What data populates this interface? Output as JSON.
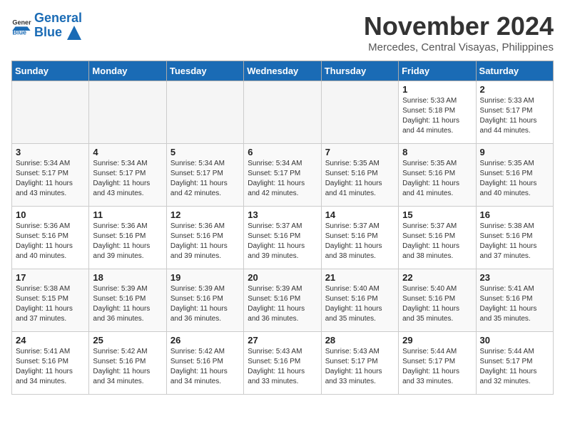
{
  "header": {
    "logo_text_general": "General",
    "logo_text_blue": "Blue",
    "month_title": "November 2024",
    "location": "Mercedes, Central Visayas, Philippines"
  },
  "days_of_week": [
    "Sunday",
    "Monday",
    "Tuesday",
    "Wednesday",
    "Thursday",
    "Friday",
    "Saturday"
  ],
  "weeks": [
    [
      {
        "day": "",
        "info": ""
      },
      {
        "day": "",
        "info": ""
      },
      {
        "day": "",
        "info": ""
      },
      {
        "day": "",
        "info": ""
      },
      {
        "day": "",
        "info": ""
      },
      {
        "day": "1",
        "info": "Sunrise: 5:33 AM\nSunset: 5:18 PM\nDaylight: 11 hours and 44 minutes."
      },
      {
        "day": "2",
        "info": "Sunrise: 5:33 AM\nSunset: 5:17 PM\nDaylight: 11 hours and 44 minutes."
      }
    ],
    [
      {
        "day": "3",
        "info": "Sunrise: 5:34 AM\nSunset: 5:17 PM\nDaylight: 11 hours and 43 minutes."
      },
      {
        "day": "4",
        "info": "Sunrise: 5:34 AM\nSunset: 5:17 PM\nDaylight: 11 hours and 43 minutes."
      },
      {
        "day": "5",
        "info": "Sunrise: 5:34 AM\nSunset: 5:17 PM\nDaylight: 11 hours and 42 minutes."
      },
      {
        "day": "6",
        "info": "Sunrise: 5:34 AM\nSunset: 5:17 PM\nDaylight: 11 hours and 42 minutes."
      },
      {
        "day": "7",
        "info": "Sunrise: 5:35 AM\nSunset: 5:16 PM\nDaylight: 11 hours and 41 minutes."
      },
      {
        "day": "8",
        "info": "Sunrise: 5:35 AM\nSunset: 5:16 PM\nDaylight: 11 hours and 41 minutes."
      },
      {
        "day": "9",
        "info": "Sunrise: 5:35 AM\nSunset: 5:16 PM\nDaylight: 11 hours and 40 minutes."
      }
    ],
    [
      {
        "day": "10",
        "info": "Sunrise: 5:36 AM\nSunset: 5:16 PM\nDaylight: 11 hours and 40 minutes."
      },
      {
        "day": "11",
        "info": "Sunrise: 5:36 AM\nSunset: 5:16 PM\nDaylight: 11 hours and 39 minutes."
      },
      {
        "day": "12",
        "info": "Sunrise: 5:36 AM\nSunset: 5:16 PM\nDaylight: 11 hours and 39 minutes."
      },
      {
        "day": "13",
        "info": "Sunrise: 5:37 AM\nSunset: 5:16 PM\nDaylight: 11 hours and 39 minutes."
      },
      {
        "day": "14",
        "info": "Sunrise: 5:37 AM\nSunset: 5:16 PM\nDaylight: 11 hours and 38 minutes."
      },
      {
        "day": "15",
        "info": "Sunrise: 5:37 AM\nSunset: 5:16 PM\nDaylight: 11 hours and 38 minutes."
      },
      {
        "day": "16",
        "info": "Sunrise: 5:38 AM\nSunset: 5:16 PM\nDaylight: 11 hours and 37 minutes."
      }
    ],
    [
      {
        "day": "17",
        "info": "Sunrise: 5:38 AM\nSunset: 5:15 PM\nDaylight: 11 hours and 37 minutes."
      },
      {
        "day": "18",
        "info": "Sunrise: 5:39 AM\nSunset: 5:16 PM\nDaylight: 11 hours and 36 minutes."
      },
      {
        "day": "19",
        "info": "Sunrise: 5:39 AM\nSunset: 5:16 PM\nDaylight: 11 hours and 36 minutes."
      },
      {
        "day": "20",
        "info": "Sunrise: 5:39 AM\nSunset: 5:16 PM\nDaylight: 11 hours and 36 minutes."
      },
      {
        "day": "21",
        "info": "Sunrise: 5:40 AM\nSunset: 5:16 PM\nDaylight: 11 hours and 35 minutes."
      },
      {
        "day": "22",
        "info": "Sunrise: 5:40 AM\nSunset: 5:16 PM\nDaylight: 11 hours and 35 minutes."
      },
      {
        "day": "23",
        "info": "Sunrise: 5:41 AM\nSunset: 5:16 PM\nDaylight: 11 hours and 35 minutes."
      }
    ],
    [
      {
        "day": "24",
        "info": "Sunrise: 5:41 AM\nSunset: 5:16 PM\nDaylight: 11 hours and 34 minutes."
      },
      {
        "day": "25",
        "info": "Sunrise: 5:42 AM\nSunset: 5:16 PM\nDaylight: 11 hours and 34 minutes."
      },
      {
        "day": "26",
        "info": "Sunrise: 5:42 AM\nSunset: 5:16 PM\nDaylight: 11 hours and 34 minutes."
      },
      {
        "day": "27",
        "info": "Sunrise: 5:43 AM\nSunset: 5:16 PM\nDaylight: 11 hours and 33 minutes."
      },
      {
        "day": "28",
        "info": "Sunrise: 5:43 AM\nSunset: 5:17 PM\nDaylight: 11 hours and 33 minutes."
      },
      {
        "day": "29",
        "info": "Sunrise: 5:44 AM\nSunset: 5:17 PM\nDaylight: 11 hours and 33 minutes."
      },
      {
        "day": "30",
        "info": "Sunrise: 5:44 AM\nSunset: 5:17 PM\nDaylight: 11 hours and 32 minutes."
      }
    ]
  ]
}
